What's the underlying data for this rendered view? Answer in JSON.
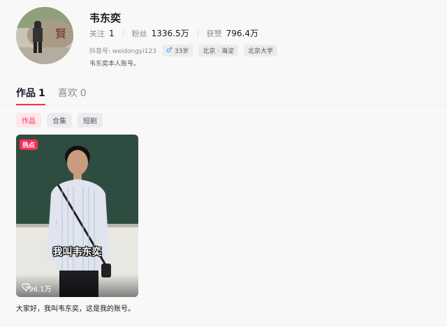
{
  "profile": {
    "name": "韦东奕",
    "stats": [
      {
        "label": "关注",
        "value": "1"
      },
      {
        "label": "粉丝",
        "value": "1336.5万"
      },
      {
        "label": "获赞",
        "value": "796.4万"
      }
    ],
    "douyin_id": "抖音号: weidongyi123",
    "tags": {
      "gender_icon": "♂",
      "age": "33岁",
      "location": "北京 · 海淀",
      "school": "北京大学"
    },
    "bio": "韦东奕本人账号。"
  },
  "tabs": [
    {
      "label": "作品",
      "count": "1"
    },
    {
      "label": "喜欢",
      "count": "0"
    }
  ],
  "filters": [
    "作品",
    "合集",
    "短剧"
  ],
  "video": {
    "badge": "热点",
    "caption": "我叫韦东奕",
    "likes": "796.1万",
    "description": "大家好，我叫韦东奕，这是我的账号。"
  },
  "colors": {
    "accent": "#fe2c55",
    "male": "#3e8bf1"
  }
}
